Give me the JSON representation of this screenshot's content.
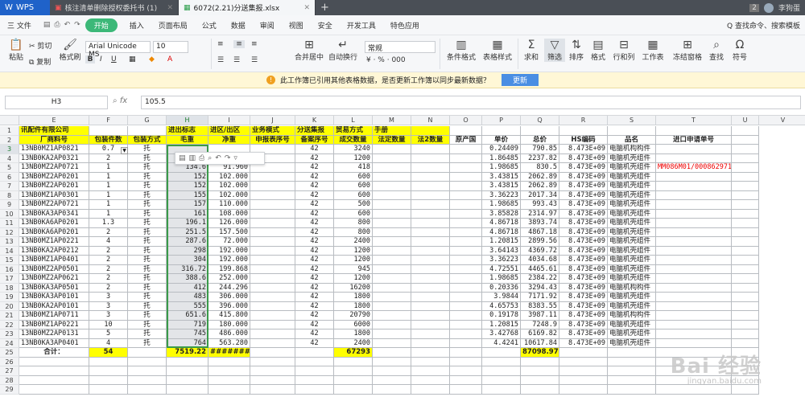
{
  "titlebar": {
    "app": "WPS",
    "tabs": [
      {
        "label": "核注清单删除授权委托书 (1)",
        "active": false
      },
      {
        "label": "6072(2.21)分送集报.xlsx",
        "active": true
      }
    ],
    "new_tab": "+",
    "badge": "2",
    "user": "李狗蛋"
  },
  "menubar": {
    "file": "三 文件",
    "tabs": [
      "开始",
      "插入",
      "页面布局",
      "公式",
      "数据",
      "审阅",
      "视图",
      "安全",
      "开发工具",
      "特色应用"
    ],
    "right": [
      "Q 查找命令、搜索模板"
    ]
  },
  "ribbon": {
    "paste": "粘贴",
    "cut": "剪切",
    "copy": "复制",
    "format_painter": "格式刷",
    "font_name": "Arial Unicode MS",
    "font_size": "10",
    "bold": "B",
    "italic": "I",
    "underline": "U",
    "merge": "合并居中",
    "wrap": "自动换行",
    "number_format": "常规",
    "cond_format": "条件格式",
    "table_style": "表格样式",
    "sum": "求和",
    "filter": "筛选",
    "sort": "排序",
    "format": "格式",
    "row_col": "行和列",
    "worksheet": "工作表",
    "freeze": "冻结窗格",
    "find": "查找",
    "symbol": "符号"
  },
  "notice": {
    "text": "此工作簿已引用其他表格数据，是否更新工作簿以同步最新数据？",
    "button": "更新"
  },
  "formula": {
    "name_box": "H3",
    "value": "105.5"
  },
  "columns": [
    "E",
    "F",
    "G",
    "H",
    "I",
    "J",
    "K",
    "L",
    "M",
    "N",
    "O",
    "P",
    "Q",
    "R",
    "S",
    "T",
    "U",
    "V"
  ],
  "rows": [
    [
      "讯配件有限公司",
      "",
      "",
      "进出标志",
      "进区/出区",
      "业务模式",
      "分送集报",
      "贸易方式",
      "手册",
      "",
      "",
      "",
      "",
      "",
      "",
      "",
      ""
    ],
    [
      "厂商料号",
      "包装件数",
      "包装方式",
      "毛重",
      "净重",
      "申报表序号",
      "备案序号",
      "成交数量",
      "法定数量",
      "法2数量",
      "原产国",
      "单价",
      "总价",
      "HS编码",
      "品名",
      "进口申请单号",
      ""
    ],
    [
      "13NB0MZ1AP0821",
      "0.7",
      "托",
      "",
      "",
      "",
      "42",
      "3240",
      "",
      "",
      "",
      "0.24409",
      "790.85",
      "8.473E+09",
      "电脑机构构件",
      "",
      ""
    ],
    [
      "13NB0KA2AP0321",
      "2",
      "托",
      "",
      "",
      "",
      "42",
      "1200",
      "",
      "",
      "",
      "1.86485",
      "2237.82",
      "8.473E+09",
      "电脑机壳组件",
      "",
      ""
    ],
    [
      "13NB0MZ2AP0721",
      "1",
      "托",
      "134.6",
      "91.960",
      "",
      "42",
      "418",
      "",
      "",
      "",
      "1.98685",
      "830.5",
      "8.473E+09",
      "电脑机壳组件",
      "MM086M01/0008629713",
      ""
    ],
    [
      "13NB0MZ2AP0201",
      "1",
      "托",
      "152",
      "102.000",
      "",
      "42",
      "600",
      "",
      "",
      "",
      "3.43815",
      "2062.89",
      "8.473E+09",
      "电脑机壳组件",
      "",
      ""
    ],
    [
      "13NB0MZ2AP0201",
      "1",
      "托",
      "152",
      "102.000",
      "",
      "42",
      "600",
      "",
      "",
      "",
      "3.43815",
      "2062.89",
      "8.473E+09",
      "电脑机壳组件",
      "",
      ""
    ],
    [
      "13NB0MZ1AP0301",
      "1",
      "托",
      "155",
      "102.000",
      "",
      "42",
      "600",
      "",
      "",
      "",
      "3.36223",
      "2017.34",
      "8.473E+09",
      "电脑机壳组件",
      "",
      ""
    ],
    [
      "13NB0MZ2AP0721",
      "1",
      "托",
      "157",
      "110.000",
      "",
      "42",
      "500",
      "",
      "",
      "",
      "1.98685",
      "993.43",
      "8.473E+09",
      "电脑机壳组件",
      "",
      ""
    ],
    [
      "13NB0KA3AP0341",
      "1",
      "托",
      "161",
      "108.000",
      "",
      "42",
      "600",
      "",
      "",
      "",
      "3.85828",
      "2314.97",
      "8.473E+09",
      "电脑机壳组件",
      "",
      ""
    ],
    [
      "13NB0KA6AP0201",
      "1.3",
      "托",
      "196.1",
      "126.000",
      "",
      "42",
      "800",
      "",
      "",
      "",
      "4.86718",
      "3893.74",
      "8.473E+09",
      "电脑机壳组件",
      "",
      ""
    ],
    [
      "13NB0KA6AP0201",
      "2",
      "托",
      "251.5",
      "157.500",
      "",
      "42",
      "800",
      "",
      "",
      "",
      "4.86718",
      "4867.18",
      "8.473E+09",
      "电脑机壳组件",
      "",
      ""
    ],
    [
      "13NB0MZ1AP0221",
      "4",
      "托",
      "287.6",
      "72.000",
      "",
      "42",
      "2400",
      "",
      "",
      "",
      "1.20815",
      "2899.56",
      "8.473E+09",
      "电脑机壳组件",
      "",
      ""
    ],
    [
      "13NB0KA2AP0212",
      "2",
      "托",
      "298",
      "192.000",
      "",
      "42",
      "1200",
      "",
      "",
      "",
      "3.64143",
      "4369.72",
      "8.473E+09",
      "电脑机壳组件",
      "",
      ""
    ],
    [
      "13NB0MZ1AP0401",
      "2",
      "托",
      "304",
      "192.000",
      "",
      "42",
      "1200",
      "",
      "",
      "",
      "3.36223",
      "4034.68",
      "8.473E+09",
      "电脑机壳组件",
      "",
      ""
    ],
    [
      "13NB0MZ2AP0501",
      "2",
      "托",
      "316.72",
      "199.868",
      "",
      "42",
      "945",
      "",
      "",
      "",
      "4.72551",
      "4465.61",
      "8.473E+09",
      "电脑机壳组件",
      "",
      ""
    ],
    [
      "13NB0MZ2AP0621",
      "2",
      "托",
      "388.6",
      "252.000",
      "",
      "42",
      "1200",
      "",
      "",
      "",
      "1.98685",
      "2384.22",
      "8.473E+09",
      "电脑机壳组件",
      "",
      ""
    ],
    [
      "13NB0KA3AP0501",
      "2",
      "托",
      "412",
      "244.296",
      "",
      "42",
      "16200",
      "",
      "",
      "",
      "0.20336",
      "3294.43",
      "8.473E+09",
      "电脑机构构件",
      "",
      ""
    ],
    [
      "13NB0KA3AP0101",
      "3",
      "托",
      "483",
      "306.000",
      "",
      "42",
      "1800",
      "",
      "",
      "",
      "3.9844",
      "7171.92",
      "8.473E+09",
      "电脑机壳组件",
      "",
      ""
    ],
    [
      "13NB0KA2AP0101",
      "3",
      "托",
      "555",
      "396.000",
      "",
      "42",
      "1800",
      "",
      "",
      "",
      "4.65753",
      "8383.55",
      "8.473E+09",
      "电脑机壳组件",
      "",
      ""
    ],
    [
      "13NB0MZ1AP0711",
      "3",
      "托",
      "651.6",
      "415.800",
      "",
      "42",
      "20790",
      "",
      "",
      "",
      "0.19178",
      "3987.11",
      "8.473E+09",
      "电脑机构构件",
      "",
      ""
    ],
    [
      "13NB0MZ1AP0221",
      "10",
      "托",
      "719",
      "180.000",
      "",
      "42",
      "6000",
      "",
      "",
      "",
      "1.20815",
      "7248.9",
      "8.473E+09",
      "电脑机壳组件",
      "",
      ""
    ],
    [
      "13NB0MZ2AP0131",
      "5",
      "托",
      "745",
      "486.000",
      "",
      "42",
      "1800",
      "",
      "",
      "",
      "3.42768",
      "6169.82",
      "8.473E+09",
      "电脑机壳组件",
      "",
      ""
    ],
    [
      "13NB0KA3AP0401",
      "4",
      "托",
      "764",
      "563.280",
      "",
      "42",
      "2400",
      "",
      "",
      "",
      "4.4241",
      "10617.84",
      "8.473E+09",
      "电脑机壳组件",
      "",
      ""
    ],
    [
      "合计：",
      "54",
      "",
      "7519.22",
      "########",
      "",
      "",
      "67293",
      "",
      "",
      "",
      "",
      "87098.97",
      "",
      "",
      "",
      ""
    ],
    [
      "",
      "",
      "",
      "",
      "",
      "",
      "",
      "",
      "",
      "",
      "",
      "",
      "",
      "",
      "",
      "",
      ""
    ],
    [
      "",
      "",
      "",
      "",
      "",
      "",
      "",
      "",
      "",
      "",
      "",
      "",
      "",
      "",
      "",
      "",
      ""
    ],
    [
      "",
      "",
      "",
      "",
      "",
      "",
      "",
      "",
      "",
      "",
      "",
      "",
      "",
      "",
      "",
      "",
      ""
    ],
    [
      "",
      "",
      "",
      "",
      "",
      "",
      "",
      "",
      "",
      "",
      "",
      "",
      "",
      "",
      "",
      "",
      ""
    ]
  ],
  "row_numbers": [
    "1",
    "2",
    "3",
    "4",
    "5",
    "6",
    "7",
    "8",
    "9",
    "10",
    "11",
    "12",
    "13",
    "14",
    "15",
    "16",
    "17",
    "18",
    "19",
    "20",
    "21",
    "22",
    "23",
    "24",
    "25",
    "26",
    "27",
    "28",
    "29"
  ],
  "watermark": {
    "brand": "Bai 经验",
    "url": "jingyan.baidu.com"
  }
}
